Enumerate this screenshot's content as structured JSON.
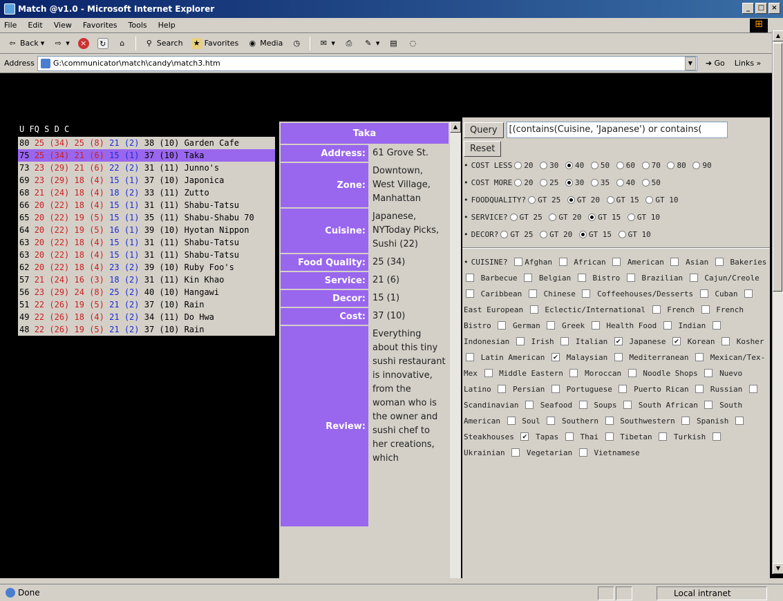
{
  "window": {
    "title": "Match @v1.0 - Microsoft Internet Explorer"
  },
  "menu": [
    "File",
    "Edit",
    "View",
    "Favorites",
    "Tools",
    "Help"
  ],
  "toolbar": {
    "back": "Back",
    "search": "Search",
    "favorites": "Favorites",
    "media": "Media"
  },
  "address": {
    "label": "Address",
    "value": "G:\\communicator\\match\\candy\\match3.htm",
    "go": "Go",
    "links": "Links"
  },
  "results": {
    "header": "U FQ S D C",
    "rows": [
      {
        "u": "80",
        "fq": "25",
        "fqn": "(34)",
        "s": "25",
        "sn": "(8)",
        "d": "21",
        "dn": "(2)",
        "c": "38",
        "cn": "(10)",
        "name": "Garden Cafe"
      },
      {
        "u": "75",
        "fq": "25",
        "fqn": "(34)",
        "s": "21",
        "sn": "(6)",
        "d": "15",
        "dn": "(1)",
        "c": "37",
        "cn": "(10)",
        "name": "Taka"
      },
      {
        "u": "73",
        "fq": "23",
        "fqn": "(29)",
        "s": "21",
        "sn": "(6)",
        "d": "22",
        "dn": "(2)",
        "c": "31",
        "cn": "(11)",
        "name": "Junno's"
      },
      {
        "u": "69",
        "fq": "23",
        "fqn": "(29)",
        "s": "18",
        "sn": "(4)",
        "d": "15",
        "dn": "(1)",
        "c": "37",
        "cn": "(10)",
        "name": "Japonica"
      },
      {
        "u": "68",
        "fq": "21",
        "fqn": "(24)",
        "s": "18",
        "sn": "(4)",
        "d": "18",
        "dn": "(2)",
        "c": "33",
        "cn": "(11)",
        "name": "Zutto"
      },
      {
        "u": "66",
        "fq": "20",
        "fqn": "(22)",
        "s": "18",
        "sn": "(4)",
        "d": "15",
        "dn": "(1)",
        "c": "31",
        "cn": "(11)",
        "name": "Shabu-Tatsu"
      },
      {
        "u": "65",
        "fq": "20",
        "fqn": "(22)",
        "s": "19",
        "sn": "(5)",
        "d": "15",
        "dn": "(1)",
        "c": "35",
        "cn": "(11)",
        "name": "Shabu-Shabu 70"
      },
      {
        "u": "64",
        "fq": "20",
        "fqn": "(22)",
        "s": "19",
        "sn": "(5)",
        "d": "16",
        "dn": "(1)",
        "c": "39",
        "cn": "(10)",
        "name": "Hyotan Nippon"
      },
      {
        "u": "63",
        "fq": "20",
        "fqn": "(22)",
        "s": "18",
        "sn": "(4)",
        "d": "15",
        "dn": "(1)",
        "c": "31",
        "cn": "(11)",
        "name": "Shabu-Tatsu"
      },
      {
        "u": "63",
        "fq": "20",
        "fqn": "(22)",
        "s": "18",
        "sn": "(4)",
        "d": "15",
        "dn": "(1)",
        "c": "31",
        "cn": "(11)",
        "name": "Shabu-Tatsu"
      },
      {
        "u": "62",
        "fq": "20",
        "fqn": "(22)",
        "s": "18",
        "sn": "(4)",
        "d": "23",
        "dn": "(2)",
        "c": "39",
        "cn": "(10)",
        "name": "Ruby Foo's"
      },
      {
        "u": "57",
        "fq": "21",
        "fqn": "(24)",
        "s": "16",
        "sn": "(3)",
        "d": "18",
        "dn": "(2)",
        "c": "31",
        "cn": "(11)",
        "name": "Kin Khao"
      },
      {
        "u": "56",
        "fq": "23",
        "fqn": "(29)",
        "s": "24",
        "sn": "(8)",
        "d": "25",
        "dn": "(2)",
        "c": "40",
        "cn": "(10)",
        "name": "Hangawi"
      },
      {
        "u": "51",
        "fq": "22",
        "fqn": "(26)",
        "s": "19",
        "sn": "(5)",
        "d": "21",
        "dn": "(2)",
        "c": "37",
        "cn": "(10)",
        "name": "Rain"
      },
      {
        "u": "49",
        "fq": "22",
        "fqn": "(26)",
        "s": "18",
        "sn": "(4)",
        "d": "21",
        "dn": "(2)",
        "c": "34",
        "cn": "(11)",
        "name": "Do Hwa"
      },
      {
        "u": "48",
        "fq": "22",
        "fqn": "(26)",
        "s": "19",
        "sn": "(5)",
        "d": "21",
        "dn": "(2)",
        "c": "37",
        "cn": "(10)",
        "name": "Rain"
      }
    ],
    "selected_index": 1
  },
  "detail": {
    "name": "Taka",
    "fields": [
      {
        "key": "Address:",
        "value": "61 Grove St."
      },
      {
        "key": "Zone:",
        "value": "Downtown, West Village, Manhattan"
      },
      {
        "key": "Cuisine:",
        "value": "Japanese, NYToday Picks, Sushi (22)"
      },
      {
        "key": "Food Quality:",
        "value": "25 (34)"
      },
      {
        "key": "Service:",
        "value": "21 (6)"
      },
      {
        "key": "Decor:",
        "value": "15 (1)"
      },
      {
        "key": "Cost:",
        "value": "37 (10)"
      },
      {
        "key": "Review:",
        "value": "Everything about this tiny sushi restaurant is innovative, from the woman who is the owner and sushi chef to her creations, which"
      }
    ]
  },
  "query": {
    "query_label": "Query",
    "reset_label": "Reset",
    "query_text": "[(contains(Cuisine, 'Japanese') or contains(",
    "costless": {
      "label": "COST LESS",
      "options": [
        "20",
        "30",
        "40",
        "50",
        "60",
        "70",
        "80",
        "90"
      ],
      "selected": "40"
    },
    "costmore": {
      "label": "COST MORE",
      "options": [
        "20",
        "25",
        "30",
        "35",
        "40",
        "50"
      ],
      "selected": "30"
    },
    "food": {
      "label": "FOODQUALITY?",
      "options": [
        "GT 25",
        "GT 20",
        "GT 15",
        "GT 10"
      ],
      "selected": "GT 20"
    },
    "service": {
      "label": "SERVICE?",
      "options": [
        "GT 25",
        "GT 20",
        "GT 15",
        "GT 10"
      ],
      "selected": "GT 15"
    },
    "decor": {
      "label": "DECOR?",
      "options": [
        "GT 25",
        "GT 20",
        "GT 15",
        "GT 10"
      ],
      "selected": "GT 15"
    },
    "cuisine_label": "CUISINE?",
    "cuisines": [
      {
        "name": "Afghan",
        "checked": false
      },
      {
        "name": "African",
        "checked": false
      },
      {
        "name": "American",
        "checked": false
      },
      {
        "name": "Asian",
        "checked": false
      },
      {
        "name": "Bakeries",
        "checked": false
      },
      {
        "name": "Barbecue",
        "checked": false
      },
      {
        "name": "Belgian",
        "checked": false
      },
      {
        "name": "Bistro",
        "checked": false
      },
      {
        "name": "Brazilian",
        "checked": false
      },
      {
        "name": "Cajun/Creole",
        "checked": false
      },
      {
        "name": "Caribbean",
        "checked": false
      },
      {
        "name": "Chinese",
        "checked": false
      },
      {
        "name": "Coffeehouses/Desserts",
        "checked": false
      },
      {
        "name": "Cuban",
        "checked": false
      },
      {
        "name": "East European",
        "checked": false
      },
      {
        "name": "Eclectic/International",
        "checked": false
      },
      {
        "name": "French",
        "checked": false
      },
      {
        "name": "French Bistro",
        "checked": false
      },
      {
        "name": "German",
        "checked": false
      },
      {
        "name": "Greek",
        "checked": false
      },
      {
        "name": "Health Food",
        "checked": false
      },
      {
        "name": "Indian",
        "checked": false
      },
      {
        "name": "Indonesian",
        "checked": false
      },
      {
        "name": "Irish",
        "checked": false
      },
      {
        "name": "Italian",
        "checked": false
      },
      {
        "name": "Japanese",
        "checked": true
      },
      {
        "name": "Korean",
        "checked": true
      },
      {
        "name": "Kosher",
        "checked": false
      },
      {
        "name": "Latin American",
        "checked": false
      },
      {
        "name": "Malaysian",
        "checked": true
      },
      {
        "name": "Mediterranean",
        "checked": false
      },
      {
        "name": "Mexican/Tex-Mex",
        "checked": false
      },
      {
        "name": "Middle Eastern",
        "checked": false
      },
      {
        "name": "Moroccan",
        "checked": false
      },
      {
        "name": "Noodle Shops",
        "checked": false
      },
      {
        "name": "Nuevo Latino",
        "checked": false
      },
      {
        "name": "Persian",
        "checked": false
      },
      {
        "name": "Portuguese",
        "checked": false
      },
      {
        "name": "Puerto Rican",
        "checked": false
      },
      {
        "name": "Russian",
        "checked": false
      },
      {
        "name": "Scandinavian",
        "checked": false
      },
      {
        "name": "Seafood",
        "checked": false
      },
      {
        "name": "Soups",
        "checked": false
      },
      {
        "name": "South African",
        "checked": false
      },
      {
        "name": "South American",
        "checked": false
      },
      {
        "name": "Soul",
        "checked": false
      },
      {
        "name": "Southern",
        "checked": false
      },
      {
        "name": "Southwestern",
        "checked": false
      },
      {
        "name": "Spanish",
        "checked": false
      },
      {
        "name": "Steakhouses",
        "checked": false
      },
      {
        "name": "Tapas",
        "checked": true
      },
      {
        "name": "Thai",
        "checked": false
      },
      {
        "name": "Tibetan",
        "checked": false
      },
      {
        "name": "Turkish",
        "checked": false
      },
      {
        "name": "Ukrainian",
        "checked": false
      },
      {
        "name": "Vegetarian",
        "checked": false
      },
      {
        "name": "Vietnamese",
        "checked": false
      }
    ]
  },
  "status": {
    "text": "Done",
    "zone": "Local intranet"
  },
  "colors": {
    "accent": "#9966ee",
    "red": "#cc1f1f",
    "blue": "#1a2bd6",
    "titlebar": "#0a246a"
  }
}
